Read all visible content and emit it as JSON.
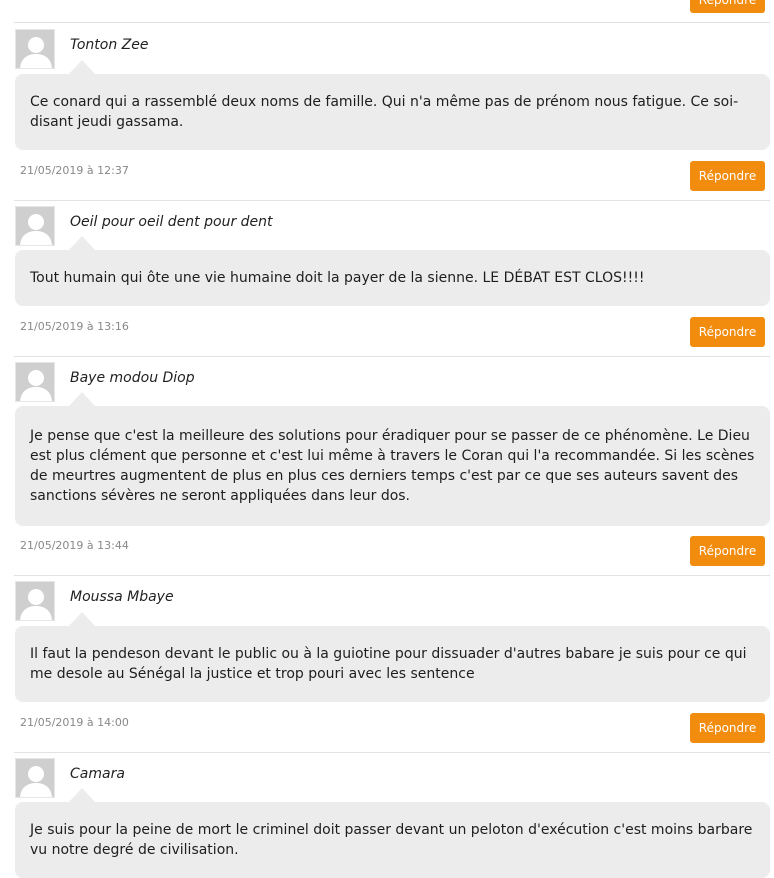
{
  "reply_label": "Répondre",
  "accent_color": "#f28c0f",
  "comments": [
    {
      "author": "Tonton Zee",
      "text": "Ce conard qui a rassemblé deux noms de famille. Qui n'a même pas de prénom nous fatigue. Ce soi-disant jeudi gassama.",
      "date": "21/05/2019 à 12:37"
    },
    {
      "author": "Oeil pour oeil dent pour dent",
      "text": "Tout humain qui ôte une vie humaine doit la payer de la sienne. LE DÉBAT EST CLOS!!!!",
      "date": "21/05/2019 à 13:16"
    },
    {
      "author": "Baye modou Diop",
      "text": "Je pense que c'est la meilleure des solutions pour éradiquer pour se passer de ce phénomène. Le Dieu est plus clément que personne et c'est lui même à travers le Coran qui l'a recommandée. Si les scènes de meurtres augmentent de plus en plus ces derniers temps c'est par ce que ses auteurs savent des sanctions sévères ne seront appliquées dans leur dos.",
      "date": "21/05/2019 à 13:44"
    },
    {
      "author": "Moussa Mbaye",
      "text": "Il faut la pendeson devant le public ou à la guiotine pour dissuader d'autres babare je suis pour ce qui me desole au Sénégal la justice et trop pouri avec les sentence",
      "date": "21/05/2019 à 14:00"
    },
    {
      "author": "Camara",
      "text": "Je suis pour la peine de mort le criminel doit passer devant un peloton d'exécution c'est moins barbare vu notre degré de civilisation.",
      "date": ""
    }
  ]
}
